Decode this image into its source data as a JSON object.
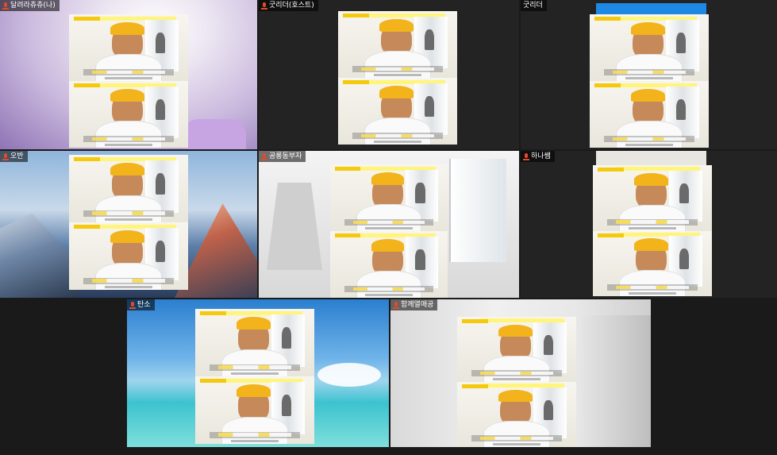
{
  "participants": [
    {
      "id": "p1",
      "name": "달려라츄츄(나)"
    },
    {
      "id": "p2",
      "name": "굿리더(호스트)"
    },
    {
      "id": "p3",
      "name": "굿리더"
    },
    {
      "id": "p4",
      "name": "오반"
    },
    {
      "id": "p5",
      "name": "공룡동부자"
    },
    {
      "id": "p6",
      "name": "하나쌤"
    },
    {
      "id": "p7",
      "name": "탄소"
    },
    {
      "id": "p8",
      "name": "함께열매공"
    }
  ],
  "colors": {
    "tag_bg": "#000000",
    "mic_muted": "#e24a2a",
    "blue_strip": "#1e88e5"
  }
}
